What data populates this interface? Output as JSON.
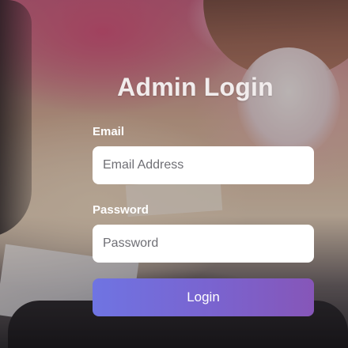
{
  "login": {
    "title": "Admin Login",
    "email_label": "Email",
    "email_placeholder": "Email Address",
    "email_value": "",
    "password_label": "Password",
    "password_placeholder": "Password",
    "password_value": "",
    "button_label": "Login"
  },
  "colors": {
    "button_gradient_start": "#6f74e2",
    "button_gradient_end": "#8656b8",
    "title_text": "#f1ecec",
    "label_text": "#ffffff",
    "input_background": "#ffffff"
  }
}
